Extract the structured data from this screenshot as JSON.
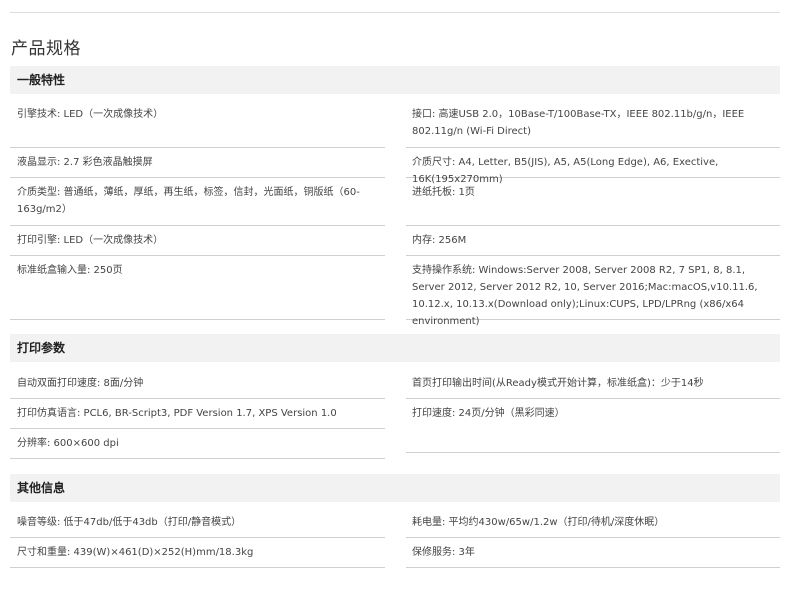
{
  "page_title": "产品规格",
  "sections": [
    {
      "title": "一般特性",
      "left": [
        "引擎技术: LED（一次成像技术）",
        "液晶显示: 2.7 彩色液晶触摸屏",
        "介质类型: 普通纸，薄纸，厚纸，再生纸，标签，信封，光面纸，铜版纸（60-163g/m2）",
        "打印引擎: LED（一次成像技术）",
        "标准纸盒输入量: 250页"
      ],
      "right": [
        "接口: 高速USB 2.0，10Base-T/100Base-TX，IEEE 802.11b/g/n，IEEE 802.11g/n (Wi-Fi Direct)",
        "介质尺寸: A4, Letter, B5(JIS), A5, A5(Long Edge), A6, Exective, 16K(195x270mm)",
        "进纸托板: 1页",
        "内存: 256M",
        "支持操作系统: Windows:Server 2008, Server 2008 R2, 7 SP1, 8, 8.1, Server 2012, Server 2012 R2, 10, Server 2016;Mac:macOS,v10.11.6, 10.12.x, 10.13.x(Download only);Linux:CUPS, LPD/LPRng (x86/x64 environment)"
      ]
    },
    {
      "title": "打印参数",
      "left": [
        "自动双面打印速度: 8面/分钟",
        "打印仿真语言: PCL6, BR-Script3, PDF Version 1.7, XPS Version 1.0",
        "分辨率: 600×600 dpi"
      ],
      "right": [
        "首页打印输出时间(从Ready模式开始计算，标准纸盒)：少于14秒",
        "打印速度: 24页/分钟（黑彩同速）"
      ]
    },
    {
      "title": "其他信息",
      "left": [
        "噪音等级: 低于47db/低于43db（打印/静音模式）",
        "尺寸和重量: 439(W)×461(D)×252(H)mm/18.3kg"
      ],
      "right": [
        "耗电量: 平均约430w/65w/1.2w（打印/待机/深度休眠）",
        "保修服务: 3年"
      ]
    }
  ]
}
